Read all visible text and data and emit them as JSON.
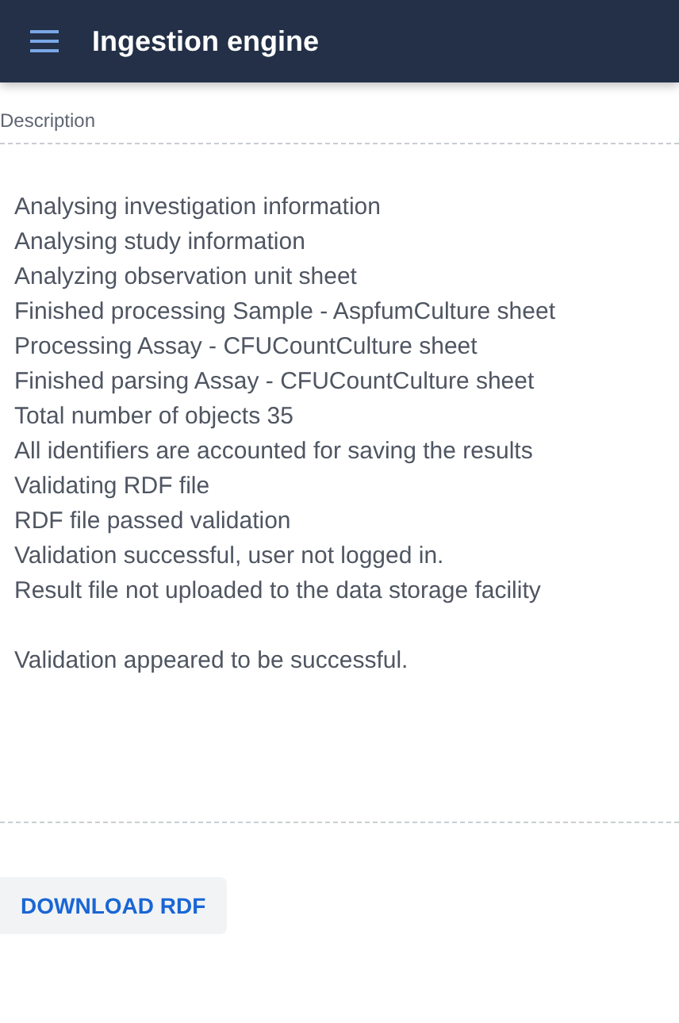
{
  "app_bar": {
    "title": "Ingestion engine"
  },
  "description": {
    "label": "Description",
    "log": [
      "Analysing investigation information",
      "Analysing study information",
      "Analyzing observation unit sheet",
      "Finished processing Sample - AspfumCulture sheet",
      "Processing Assay - CFUCountCulture sheet",
      "Finished parsing Assay - CFUCountCulture sheet",
      "Total number of objects 35",
      "All identifiers are accounted for saving the results",
      "Validating RDF file",
      "RDF file passed validation",
      "Validation successful, user not logged in.",
      "Result file not uploaded to the data storage facility"
    ],
    "result": "Validation appeared to be successful."
  },
  "buttons": [
    "DOWNLOAD RDF"
  ]
}
